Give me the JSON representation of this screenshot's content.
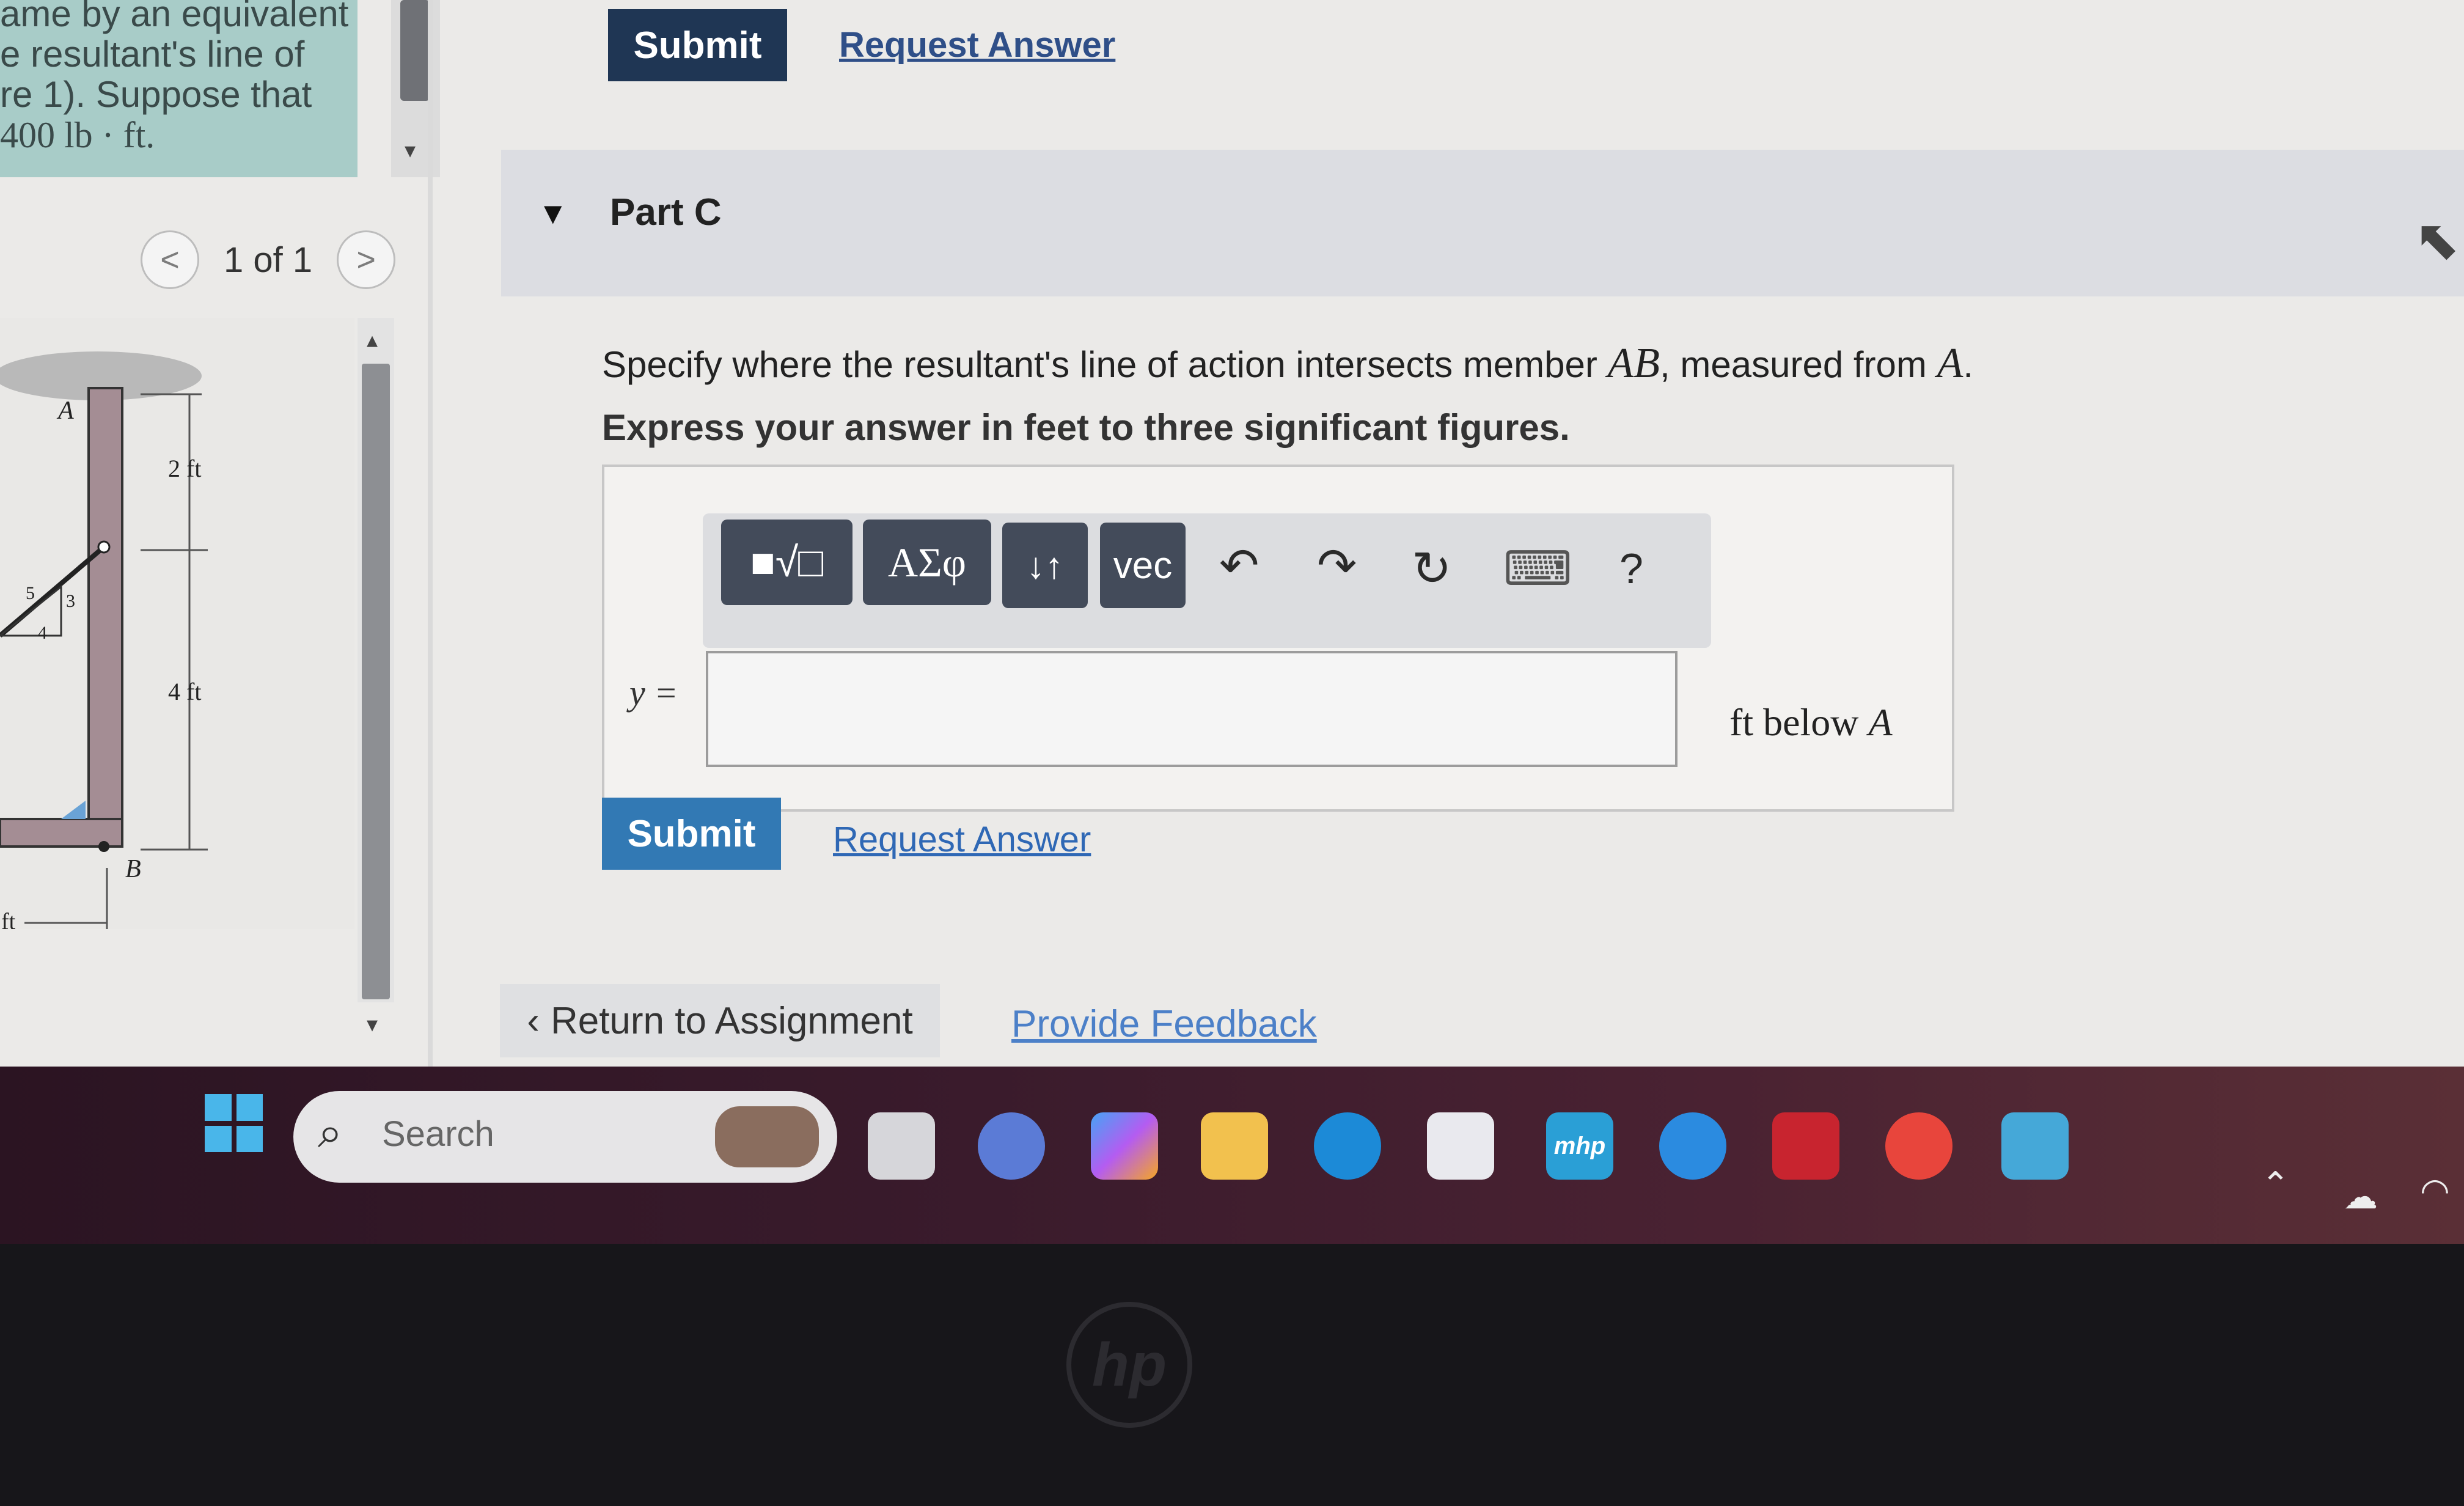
{
  "problem": {
    "lines": [
      "ame by an equivalent",
      "e resultant's line of",
      "re 1). Suppose that",
      "400 lb · ft."
    ]
  },
  "pager": {
    "prev": "<",
    "label": "1 of 1",
    "next": ">"
  },
  "figure": {
    "label_A": "A",
    "label_B": "B",
    "dim_top": "2 ft",
    "dim_bottom": "4 ft",
    "slope_5": "5",
    "slope_3": "3",
    "slope_4": "4",
    "dim_left": "ft"
  },
  "part_b": {
    "submit_label": "Submit",
    "request_label": "Request Answer"
  },
  "part_c": {
    "title": "Part C",
    "question_pre": "Specify where the resultant's line of action intersects member ",
    "question_ab": "AB",
    "question_mid": ", measured from ",
    "question_a": "A",
    "question_end": ".",
    "instruction": "Express your answer in feet to three significant figures.",
    "toolbar": {
      "templates": "■√□",
      "greek": "ΑΣφ",
      "sort": "↓↑",
      "vec": "vec",
      "undo": "↶",
      "redo": "↷",
      "reset": "↻",
      "keyboard": "⌨",
      "help": "?"
    },
    "input_label": "y =",
    "input_value": "",
    "units_pre": "ft below ",
    "units_var": "A",
    "submit_label": "Submit",
    "request_label": "Request Answer"
  },
  "footer": {
    "return_label": "Return to Assignment",
    "feedback_label": "Provide Feedback"
  },
  "taskbar": {
    "search_placeholder": "Search",
    "mhp_label": "mhp",
    "colors": {
      "accent_blue": "#3279b4",
      "header_navy": "#1f3654"
    }
  }
}
